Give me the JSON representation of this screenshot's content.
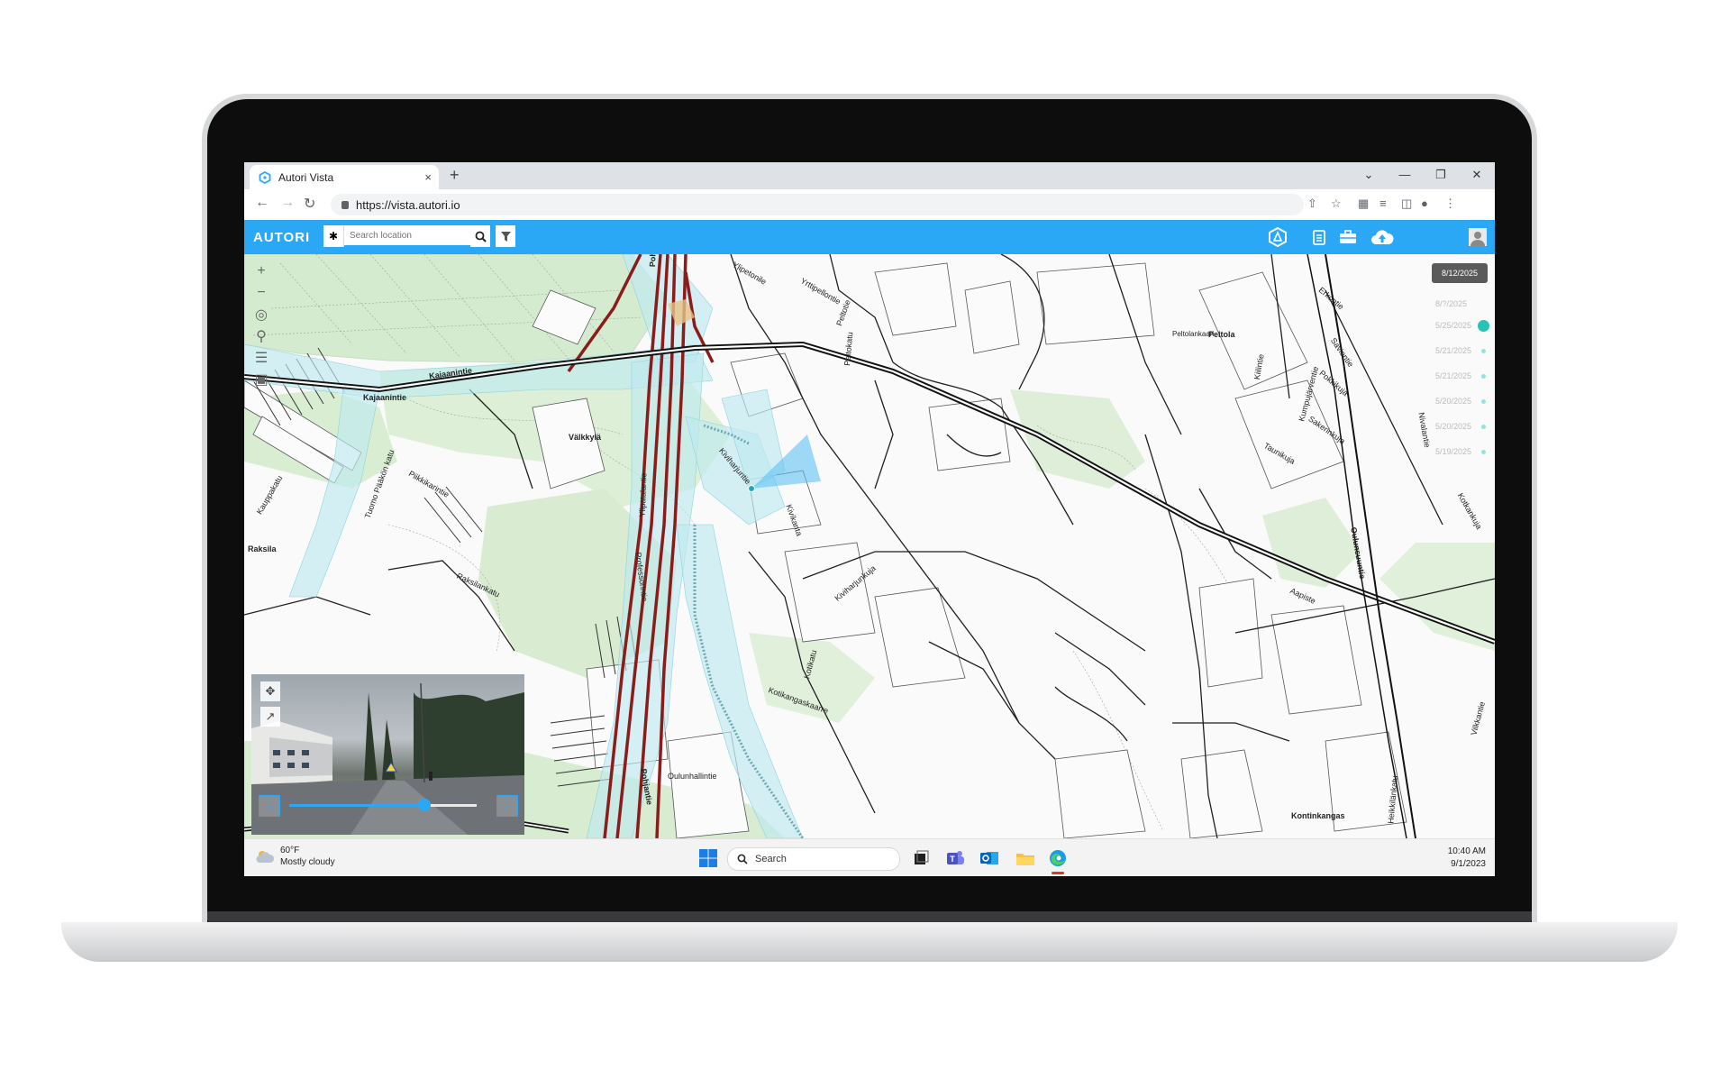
{
  "browser": {
    "tab_title": "Autori Vista",
    "tab_close": "×",
    "new_tab": "+",
    "url": "https://vista.autori.io",
    "window_controls": [
      "⌄",
      "—",
      "❐",
      "✕"
    ]
  },
  "app": {
    "logo": "AUTORI",
    "search_placeholder": "Search location",
    "accent_color": "#2aa7f5"
  },
  "map": {
    "street_labels": [
      {
        "text": "Kajaanintie",
        "bold": true
      },
      {
        "text": "Kajaanintie",
        "bold": true
      },
      {
        "text": "Pohjantie",
        "bold": true
      },
      {
        "text": "Pohjantie",
        "bold": true
      },
      {
        "text": "Välkkylä",
        "bold": true
      },
      {
        "text": "Raksila",
        "bold": true
      },
      {
        "text": "Peltola",
        "bold": true
      },
      {
        "text": "Kontinkangas",
        "bold": true
      },
      {
        "text": "Oulunsuuntie",
        "bold": true
      },
      {
        "text": "Ylipetonile",
        "bold": false
      },
      {
        "text": "Yrttipellontie",
        "bold": false
      },
      {
        "text": "Peltotie",
        "bold": false
      },
      {
        "text": "Peltokatu",
        "bold": false
      },
      {
        "text": "Peltolankaari",
        "bold": false
      },
      {
        "text": "Erkontie",
        "bold": false
      },
      {
        "text": "Kiilintie",
        "bold": false
      },
      {
        "text": "Kumpujärventie",
        "bold": false
      },
      {
        "text": "Saviontie",
        "bold": false
      },
      {
        "text": "Pokkikuja",
        "bold": false
      },
      {
        "text": "Sakerinkuja",
        "bold": false
      },
      {
        "text": "Nivalantie",
        "bold": false
      },
      {
        "text": "Taunikuja",
        "bold": false
      },
      {
        "text": "Ylipatalantie",
        "bold": false
      },
      {
        "text": "Professorintie",
        "bold": false
      },
      {
        "text": "Kiviharjuntie",
        "bold": false
      },
      {
        "text": "Kivikanta",
        "bold": false
      },
      {
        "text": "Kiviharjunkuja",
        "bold": false
      },
      {
        "text": "Kotikangaskaarre",
        "bold": false
      },
      {
        "text": "Kotikatu",
        "bold": false
      },
      {
        "text": "Aapiste",
        "bold": false
      },
      {
        "text": "Oulunhallintie",
        "bold": false
      },
      {
        "text": "Piikkikarintie",
        "bold": false
      },
      {
        "text": "Raksilankatu",
        "bold": false
      },
      {
        "text": "Tuomo Pääkön katu",
        "bold": false
      },
      {
        "text": "Kauppakatu",
        "bold": false
      },
      {
        "text": "Kotkankuja",
        "bold": false
      },
      {
        "text": "Vilkkantie",
        "bold": false
      },
      {
        "text": "Heikkilänkatu",
        "bold": false
      }
    ]
  },
  "timeline": {
    "selected_date": "8/12/2025",
    "dates": [
      "8/?/2025",
      "5/25/2025",
      "5/21/2025",
      "5/21/2025",
      "5/20/2025",
      "5/20/2025",
      "5/19/2025"
    ]
  },
  "panorama": {
    "progress": 0.72
  },
  "taskbar": {
    "temperature": "60°F",
    "condition": "Mostly cloudy",
    "search_label": "Search",
    "time": "10:40 AM",
    "date": "9/1/2023"
  }
}
